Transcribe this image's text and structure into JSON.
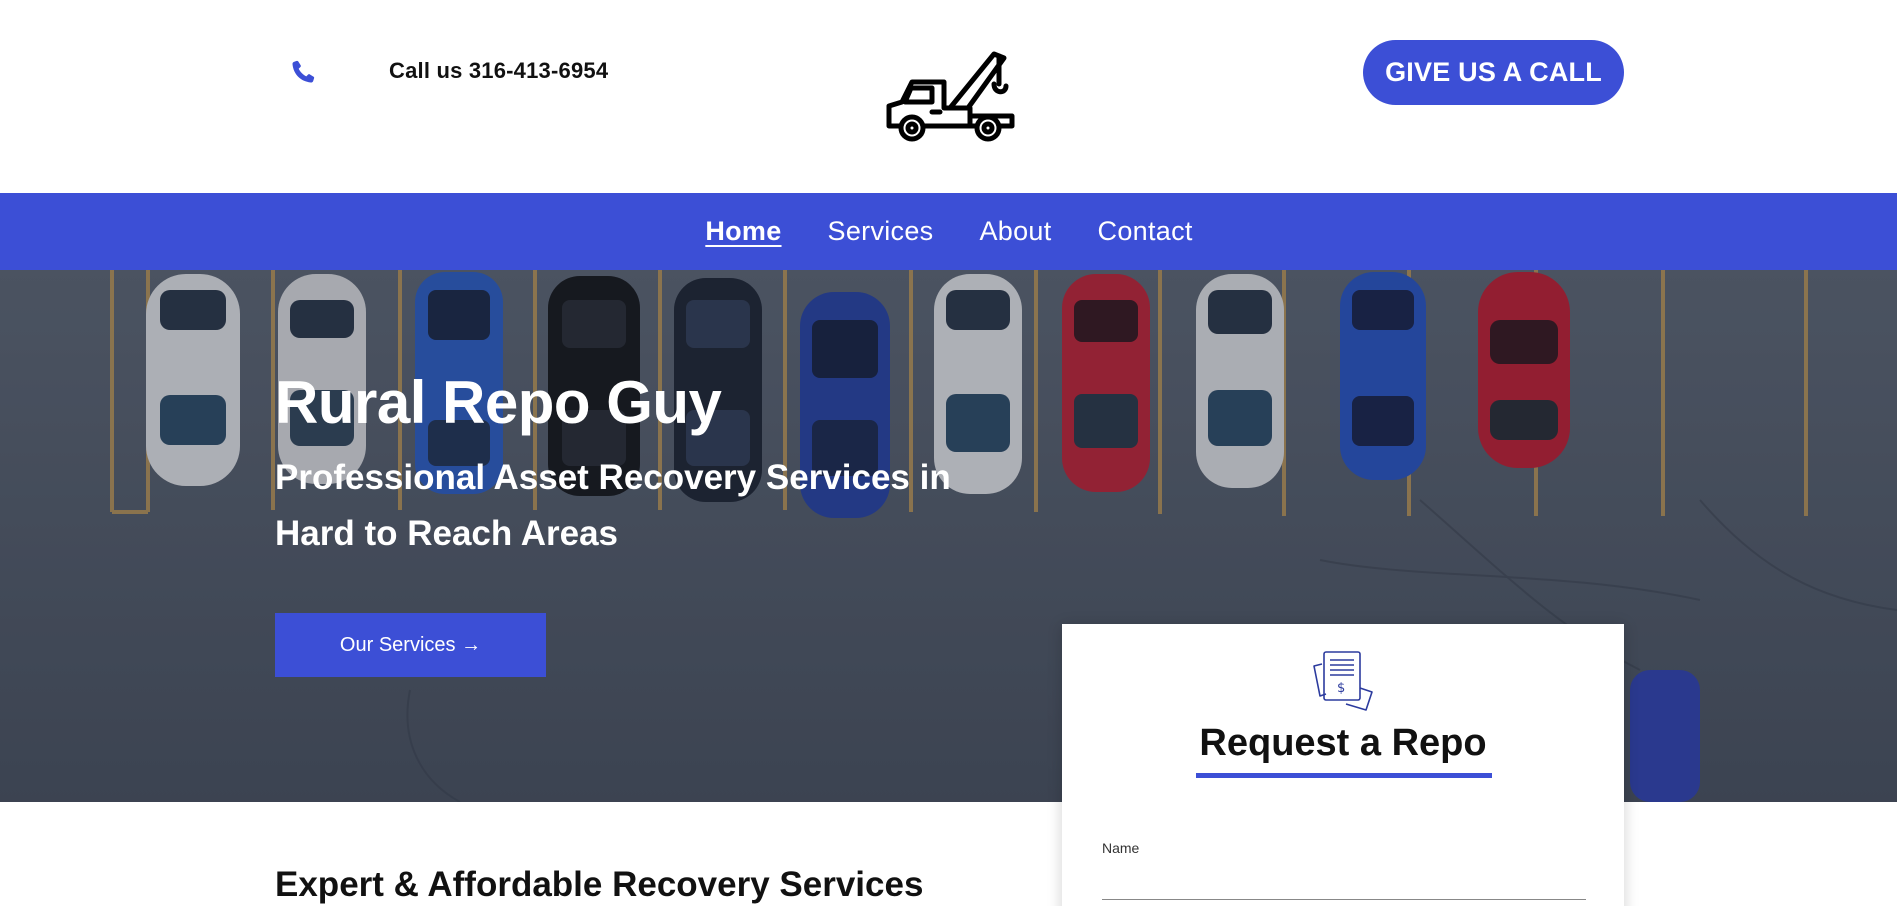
{
  "header": {
    "phone_text": "Call us 316-413-6954",
    "cta_label": "GIVE US A CALL",
    "logo_icon": "tow-truck-icon",
    "phone_icon": "phone-icon"
  },
  "nav": {
    "items": [
      {
        "label": "Home",
        "active": true
      },
      {
        "label": "Services",
        "active": false
      },
      {
        "label": "About",
        "active": false
      },
      {
        "label": "Contact",
        "active": false
      }
    ]
  },
  "hero": {
    "title": "Rural Repo Guy",
    "subtitle": "Professional Asset Recovery Services in Hard to Reach Areas",
    "button_label": "Our Services →"
  },
  "request_card": {
    "icon": "invoice-icon",
    "title": "Request a Repo",
    "fields": [
      {
        "label": "Name",
        "value": ""
      }
    ]
  },
  "section": {
    "heading": "Expert & Affordable Recovery Services"
  },
  "colors": {
    "accent": "#3c4fd6",
    "white": "#ffffff",
    "text": "#111111"
  }
}
